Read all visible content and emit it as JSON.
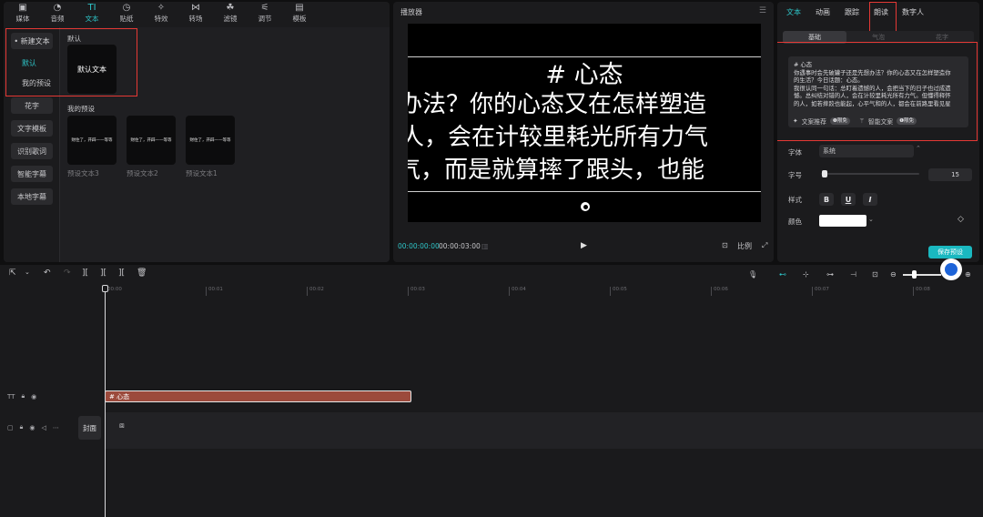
{
  "toolbar": {
    "items": [
      {
        "label": "媒体",
        "icon": "media-icon"
      },
      {
        "label": "音频",
        "icon": "audio-icon"
      },
      {
        "label": "文本",
        "icon": "text-icon",
        "active": true
      },
      {
        "label": "贴纸",
        "icon": "sticker-icon"
      },
      {
        "label": "特效",
        "icon": "effect-icon"
      },
      {
        "label": "转场",
        "icon": "transition-icon"
      },
      {
        "label": "滤镜",
        "icon": "filter-icon"
      },
      {
        "label": "调节",
        "icon": "adjust-icon"
      },
      {
        "label": "模板",
        "icon": "template-icon"
      }
    ]
  },
  "sidebar": {
    "new_text": "• 新建文本",
    "default": "默认",
    "my_presets": "我的预设",
    "fancy": "花字",
    "text_template": "文字模板",
    "recognize_lyrics": "识别歌词",
    "smart_subtitle": "智能字幕",
    "local_subtitle": "本地字幕"
  },
  "content": {
    "default_label": "默认",
    "default_card": "默认文本",
    "my_presets_label": "我的预设",
    "preset_cards": [
      {
        "preview": "财住了，开辟——等等",
        "caption": "预设文本3"
      },
      {
        "preview": "财住了，开辟——等等",
        "caption": "预设文本2"
      },
      {
        "preview": "财住了，开辟——等等",
        "caption": "预设文本1"
      }
    ]
  },
  "player": {
    "title": "播放器",
    "video_title": "# 心态",
    "line1": "办法？你的心态又在怎样塑造",
    "line2": "人，会在计较里耗光所有力气",
    "line3": "气，而是就算摔了跟头，也能",
    "time_current": "00:00:00:00",
    "time_total": "00:00:03:00",
    "ratio_label": "比例"
  },
  "properties": {
    "tabs": [
      "文本",
      "动画",
      "跟踪",
      "朗读",
      "数字人"
    ],
    "subtabs": [
      "基础",
      "气泡",
      "花字"
    ],
    "text_lines": [
      "# 心态",
      "你遇事时会先破罐子还是先想办法？你的心态又在怎样塑造你",
      "的生活？今日话题：心态。",
      "我很认同一句话：总盯着遗憾的人，会把当下的日子也过成遗",
      "憾。总纠结对错的人，会在计较里耗光所有力气。但懂得释怀",
      "的人，如若摔跤也能起，心平气和的人，都会在前路里看见星"
    ],
    "copy_recommend": "文案推荐",
    "smart_copy": "智能文案",
    "badge": "❶限免",
    "font_label": "字体",
    "font_value": "系统",
    "size_label": "字号",
    "size_value": "15",
    "style_label": "样式",
    "style_bold": "B",
    "style_underline": "U",
    "style_italic": "I",
    "color_label": "颜色",
    "save_preset": "保存预设",
    "text_color": "#ffffff",
    "accent_color": "#2ec4c7"
  },
  "timeline": {
    "ticks": [
      "00:00",
      "00:01",
      "00:02",
      "00:03",
      "00:04",
      "00:05",
      "00:06",
      "00:07",
      "00:08"
    ],
    "text_clip": "# 心态",
    "cover_label": "封面",
    "clip_color": "#9c4a3c"
  }
}
